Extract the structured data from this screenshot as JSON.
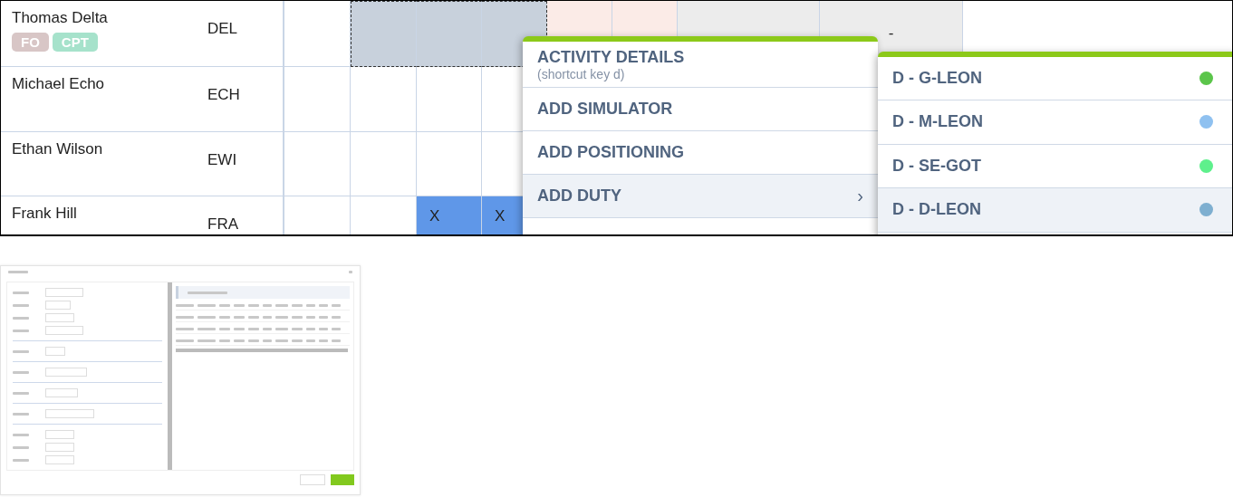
{
  "roster": {
    "rows": [
      {
        "name": "Thomas Delta",
        "code": "DEL",
        "badges": [
          {
            "label": "FO",
            "color": "#d8c6c6"
          },
          {
            "label": "CPT",
            "color": "#a6e2cb"
          }
        ],
        "cells": [
          {
            "kind": "blank"
          },
          {
            "kind": "selected"
          },
          {
            "kind": "selected"
          },
          {
            "kind": "selected"
          },
          {
            "kind": "off"
          },
          {
            "kind": "off"
          },
          {
            "kind": "grey"
          },
          {
            "kind": "grey",
            "text": "-"
          }
        ]
      },
      {
        "name": "Michael Echo",
        "code": "ECH",
        "cells": [
          {
            "kind": "blank"
          },
          {
            "kind": "blank"
          },
          {
            "kind": "blank"
          },
          {
            "kind": "blank"
          },
          {
            "kind": "blank"
          },
          {
            "kind": "blank"
          },
          {
            "kind": "blank"
          },
          {
            "kind": "blank"
          }
        ]
      },
      {
        "name": "Ethan Wilson",
        "code": "EWI",
        "cells": [
          {
            "kind": "blank"
          },
          {
            "kind": "blank"
          },
          {
            "kind": "blank"
          },
          {
            "kind": "blank"
          },
          {
            "kind": "blank"
          },
          {
            "kind": "blank"
          },
          {
            "kind": "blank"
          },
          {
            "kind": "blank"
          }
        ]
      },
      {
        "name": "Frank Hill",
        "code": "FRA",
        "cells": [
          {
            "kind": "blank"
          },
          {
            "kind": "blank"
          },
          {
            "kind": "duty",
            "text": "X"
          },
          {
            "kind": "duty",
            "text": "X"
          },
          {
            "kind": "blank"
          },
          {
            "kind": "blank"
          },
          {
            "kind": "blank"
          },
          {
            "kind": "blank"
          }
        ]
      }
    ]
  },
  "context_menu": {
    "items": [
      {
        "label": "ACTIVITY DETAILS",
        "hint": "(shortcut key d)",
        "selected": false
      },
      {
        "label": "ADD SIMULATOR",
        "selected": false
      },
      {
        "label": "ADD POSITIONING",
        "selected": false
      },
      {
        "label": "ADD DUTY",
        "arrow": "›",
        "selected": true
      }
    ]
  },
  "submenu": {
    "items": [
      {
        "label": "D - G-LEON",
        "color": "#5bc54a",
        "selected": false
      },
      {
        "label": "D - M-LEON",
        "color": "#8fc1f0",
        "selected": false
      },
      {
        "label": "D - SE-GOT",
        "color": "#5ef08c",
        "selected": false
      },
      {
        "label": "D - D-LEON",
        "color": "#7eafd0",
        "selected": true
      }
    ]
  }
}
